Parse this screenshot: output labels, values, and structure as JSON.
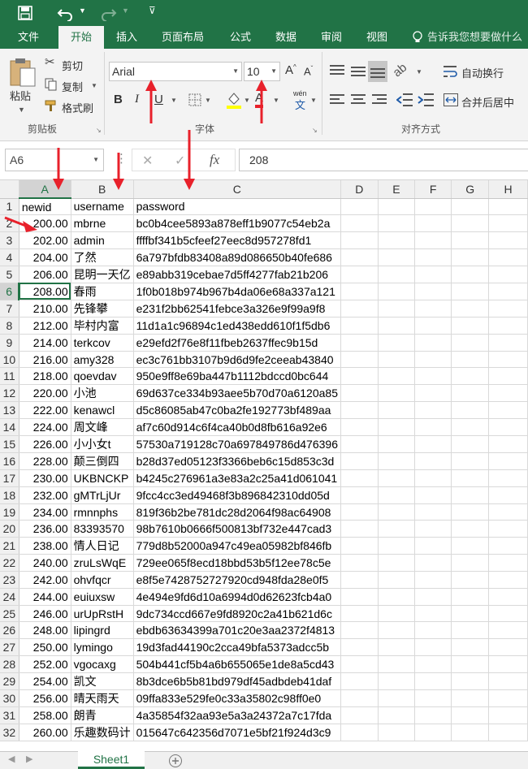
{
  "ribbon_tabs": [
    "文件",
    "开始",
    "插入",
    "页面布局",
    "公式",
    "数据",
    "审阅",
    "视图"
  ],
  "tell_me": "告诉我您想要做什么",
  "clipboard": {
    "paste": "粘贴",
    "cut": "剪切",
    "copy": "复制",
    "format_painter": "格式刷",
    "group": "剪贴板"
  },
  "font": {
    "name": "Arial",
    "size": "10",
    "group": "字体",
    "bold": "B",
    "italic": "I",
    "underline": "U",
    "phonetic": "wén"
  },
  "alignment": {
    "wrap": "自动换行",
    "merge": "合并后居中",
    "group": "对齐方式"
  },
  "name_box": "A6",
  "formula_value": "208",
  "fx": "fx",
  "columns": [
    "A",
    "B",
    "C",
    "D",
    "E",
    "F",
    "G",
    "H"
  ],
  "rows": [
    [
      "newid",
      "username",
      "password"
    ],
    [
      "200.00",
      "mbrne",
      "bc0b4cee5893a878eff1b9077c54eb2a"
    ],
    [
      "202.00",
      "admin",
      "ffffbf341b5cfeef27eec8d957278fd1"
    ],
    [
      "204.00",
      "了然",
      "6a797bfdb83408a89d086650b40fe686"
    ],
    [
      "206.00",
      "昆明一天亿",
      "e89abb319cebae7d5ff4277fab21b206"
    ],
    [
      "208.00",
      "春雨",
      "1f0b018b974b967b4da06e68a337a121"
    ],
    [
      "210.00",
      "先锋攀",
      "e231f2bb62541febce3a326e9f99a9f8"
    ],
    [
      "212.00",
      "毕村内富",
      "11d1a1c96894c1ed438edd610f1f5db6"
    ],
    [
      "214.00",
      "terkcov",
      "e29efd2f76e8f11fbeb2637ffec9b15d"
    ],
    [
      "216.00",
      "amy328",
      "ec3c761bb3107b9d6d9fe2ceeab43840"
    ],
    [
      "218.00",
      "qoevdav",
      "950e9ff8e69ba447b1112bdccd0bc644"
    ],
    [
      "220.00",
      "小池",
      "69d637ce334b93aee5b70d70a6120a85"
    ],
    [
      "222.00",
      "kenawcl",
      "d5c86085ab47c0ba2fe192773bf489aa"
    ],
    [
      "224.00",
      "周文峰",
      "af7c60d914c6f4ca40b0d8fb616a92e6"
    ],
    [
      "226.00",
      "小小女t",
      "57530a719128c70a697849786d476396"
    ],
    [
      "228.00",
      "颠三倒四",
      "b28d37ed05123f3366beb6c15d853c3d"
    ],
    [
      "230.00",
      "UKBNCKP",
      "b4245c276961a3e83a2c25a41d061041"
    ],
    [
      "232.00",
      "gMTrLjUr",
      "9fcc4cc3ed49468f3b896842310dd05d"
    ],
    [
      "234.00",
      "rmnnphs",
      "819f36b2be781dc28d2064f98ac64908"
    ],
    [
      "236.00",
      "83393570",
      "98b7610b0666f500813bf732e447cad3"
    ],
    [
      "238.00",
      "情人日记",
      "779d8b52000a947c49ea05982bf846fb"
    ],
    [
      "240.00",
      "zruLsWqE",
      "729ee065f8ecd18bbd53b5f12ee78c5e"
    ],
    [
      "242.00",
      "ohvfqcr",
      "e8f5e7428752727920cd948fda28e0f5"
    ],
    [
      "244.00",
      "euiuxsw",
      "4e494e9fd6d10a6994d0d62623fcb4a0"
    ],
    [
      "246.00",
      "urUpRstH",
      "9dc734ccd667e9fd8920c2a41b621d6c"
    ],
    [
      "248.00",
      "lipingrd",
      "ebdb63634399a701c20e3aa2372f4813"
    ],
    [
      "250.00",
      "lymingo",
      "19d3fad44190c2cca49bfa5373adcc5b"
    ],
    [
      "252.00",
      "vgocaxg",
      "504b441cf5b4a6b655065e1de8a5cd43"
    ],
    [
      "254.00",
      "凯文",
      "8b3dce6b5b81bd979df45adbdeb41daf"
    ],
    [
      "256.00",
      "晴天雨天",
      "09ffa833e529fe0c33a35802c98ff0e0"
    ],
    [
      "258.00",
      "朗青",
      "4a35854f32aa93e5a3a24372a7c17fda"
    ],
    [
      "260.00",
      "乐趣数码计",
      "015647c642356d7071e5bf21f924d3c9"
    ]
  ],
  "sheet_tab": "Sheet1"
}
